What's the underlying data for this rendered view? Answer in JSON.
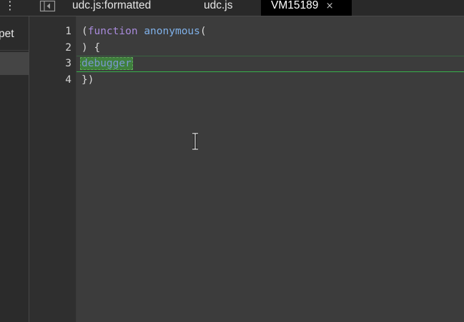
{
  "navigator": {
    "menu_icon": "kebab-menu-icon",
    "label": "pet"
  },
  "tabs": [
    {
      "label": "udc.js:formatted",
      "active": false
    },
    {
      "label": "udc.js",
      "active": false
    },
    {
      "label": "VM15189",
      "active": true,
      "close": "×"
    }
  ],
  "gutter": {
    "lines": [
      "1",
      "2",
      "3",
      "4"
    ]
  },
  "code": {
    "line1_paren": "(",
    "line1_keyword": "function",
    "line1_name": "anonymous",
    "line1_rest": "(",
    "line2": ") {",
    "line3_debugger": "debugger",
    "line4": "})"
  },
  "colors": {
    "accent_exec_line": "#37b04a",
    "keyword": "#a98bdc",
    "function_name": "#7fb0e8"
  }
}
